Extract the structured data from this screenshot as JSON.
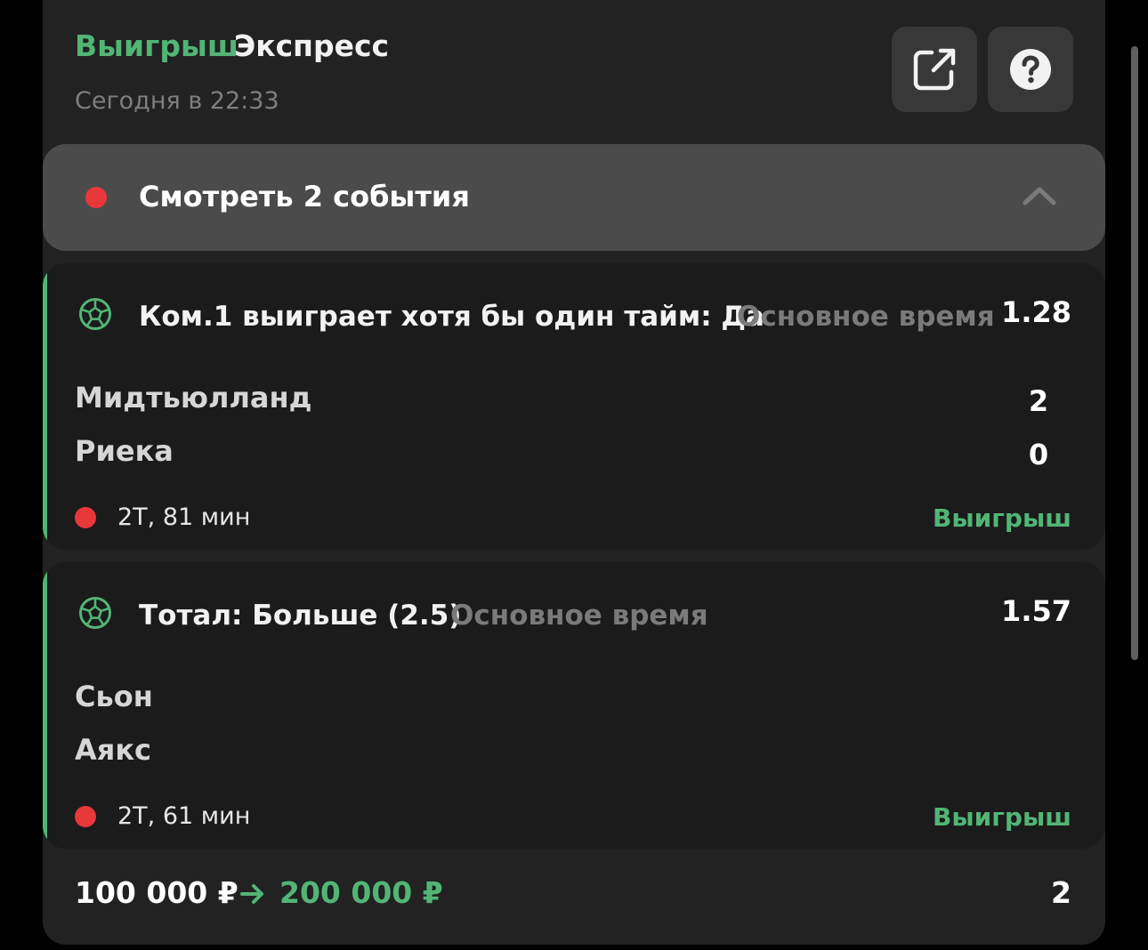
{
  "header": {
    "status": "Выигрыш",
    "bet_type": "Экспресс",
    "time": "Сегодня в 22:33",
    "share_icon": "share-external-icon",
    "help_icon": "question-circle-icon"
  },
  "events_toggle": {
    "label": "Смотреть 2 события",
    "icon": "chevron-up-icon"
  },
  "events": [
    {
      "sport_icon": "soccer-ball-icon",
      "market": "Ком.1 выиграет хотя бы один тайм: Да",
      "period": "Основное время",
      "odds": "1.28",
      "team1": "Мидтьюлланд",
      "team2": "Риека",
      "score1": "2",
      "score2": "0",
      "live": "2Т, 81 мин",
      "result": "Выигрыш"
    },
    {
      "sport_icon": "soccer-ball-icon",
      "market": "Тотал: Больше (2.5)",
      "period": "Основное время",
      "odds": "1.57",
      "team1": "Сьон",
      "team2": "Аякс",
      "live": "2Т, 61 мин",
      "result": "Выигрыш"
    }
  ],
  "footer": {
    "stake": "100 000 ₽",
    "payout": "200 000 ₽",
    "events_count": "2"
  },
  "colors": {
    "accent_green": "#52b576",
    "live_red": "#e8383a",
    "card_bg": "#222222",
    "event_bg": "#1b1b1b"
  }
}
